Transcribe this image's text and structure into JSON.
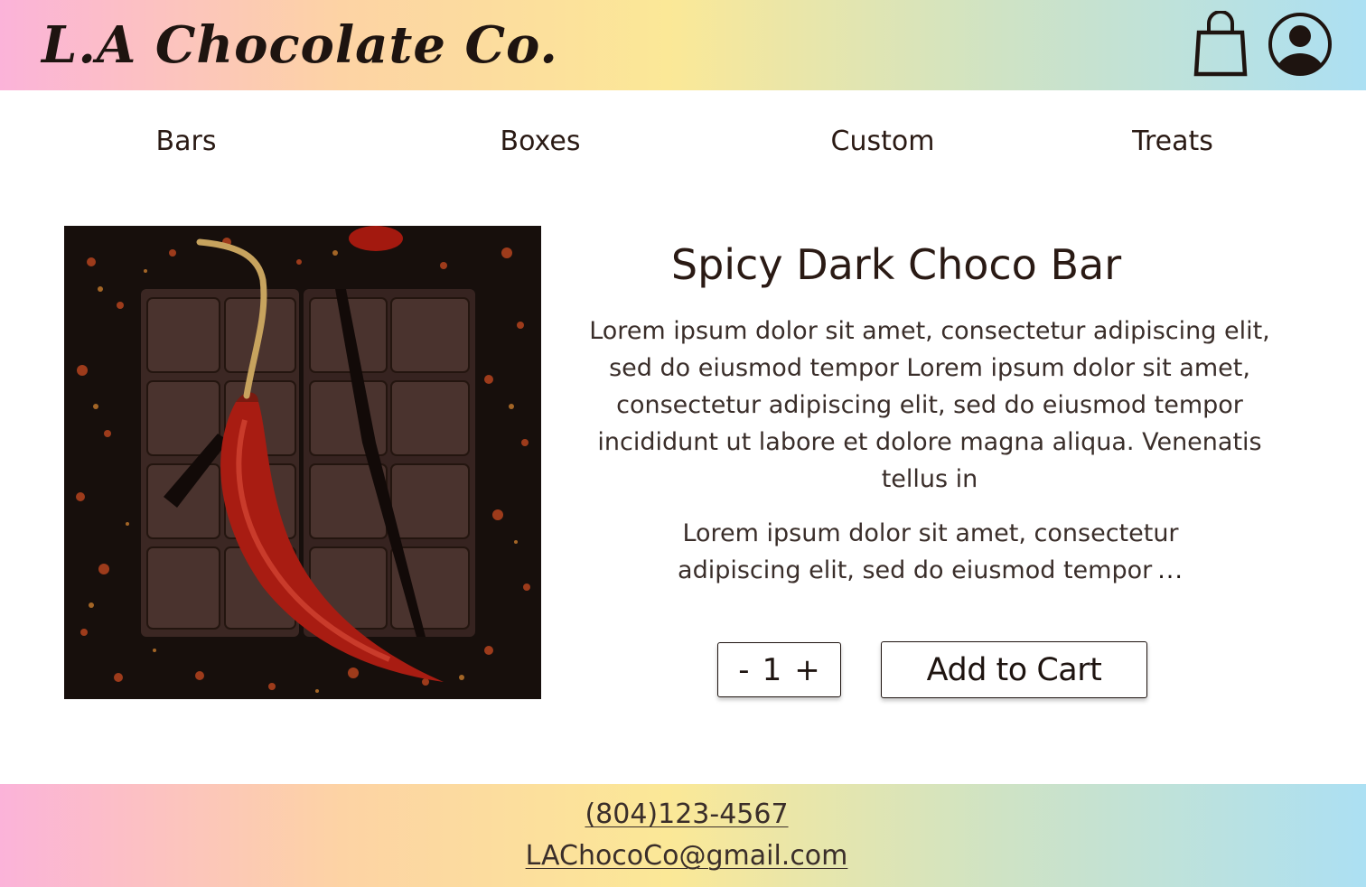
{
  "header": {
    "brand": "L.A Chocolate Co.",
    "icons": [
      "shopping-bag-icon",
      "user-account-icon"
    ]
  },
  "nav": {
    "items": [
      {
        "label": "Bars"
      },
      {
        "label": "Boxes"
      },
      {
        "label": "Custom"
      },
      {
        "label": "Treats"
      }
    ]
  },
  "product": {
    "title": "Spicy Dark Choco Bar",
    "description": "Lorem ipsum dolor sit amet, consectetur adipiscing elit, sed do eiusmod tempor  Lorem ipsum dolor sit amet, consectetur adipiscing elit, sed do eiusmod tempor incididunt ut labore et dolore magna aliqua. Venenatis tellus in",
    "description2": "Lorem ipsum dolor sit amet, consectetur adipiscing elit, sed do eiusmod tempor",
    "more": "...",
    "quantity": {
      "minus": "-",
      "value": "1",
      "plus": "+"
    },
    "add_to_cart": "Add to Cart"
  },
  "footer": {
    "phone": "(804)123-4567",
    "email": "LAChocoCo@gmail.com"
  },
  "colors": {
    "gradient_stops": [
      "#fbb3d9",
      "#fdd3a4",
      "#fbe897",
      "#cfe3c4",
      "#ace0f3"
    ],
    "text": "#2a1a14"
  }
}
